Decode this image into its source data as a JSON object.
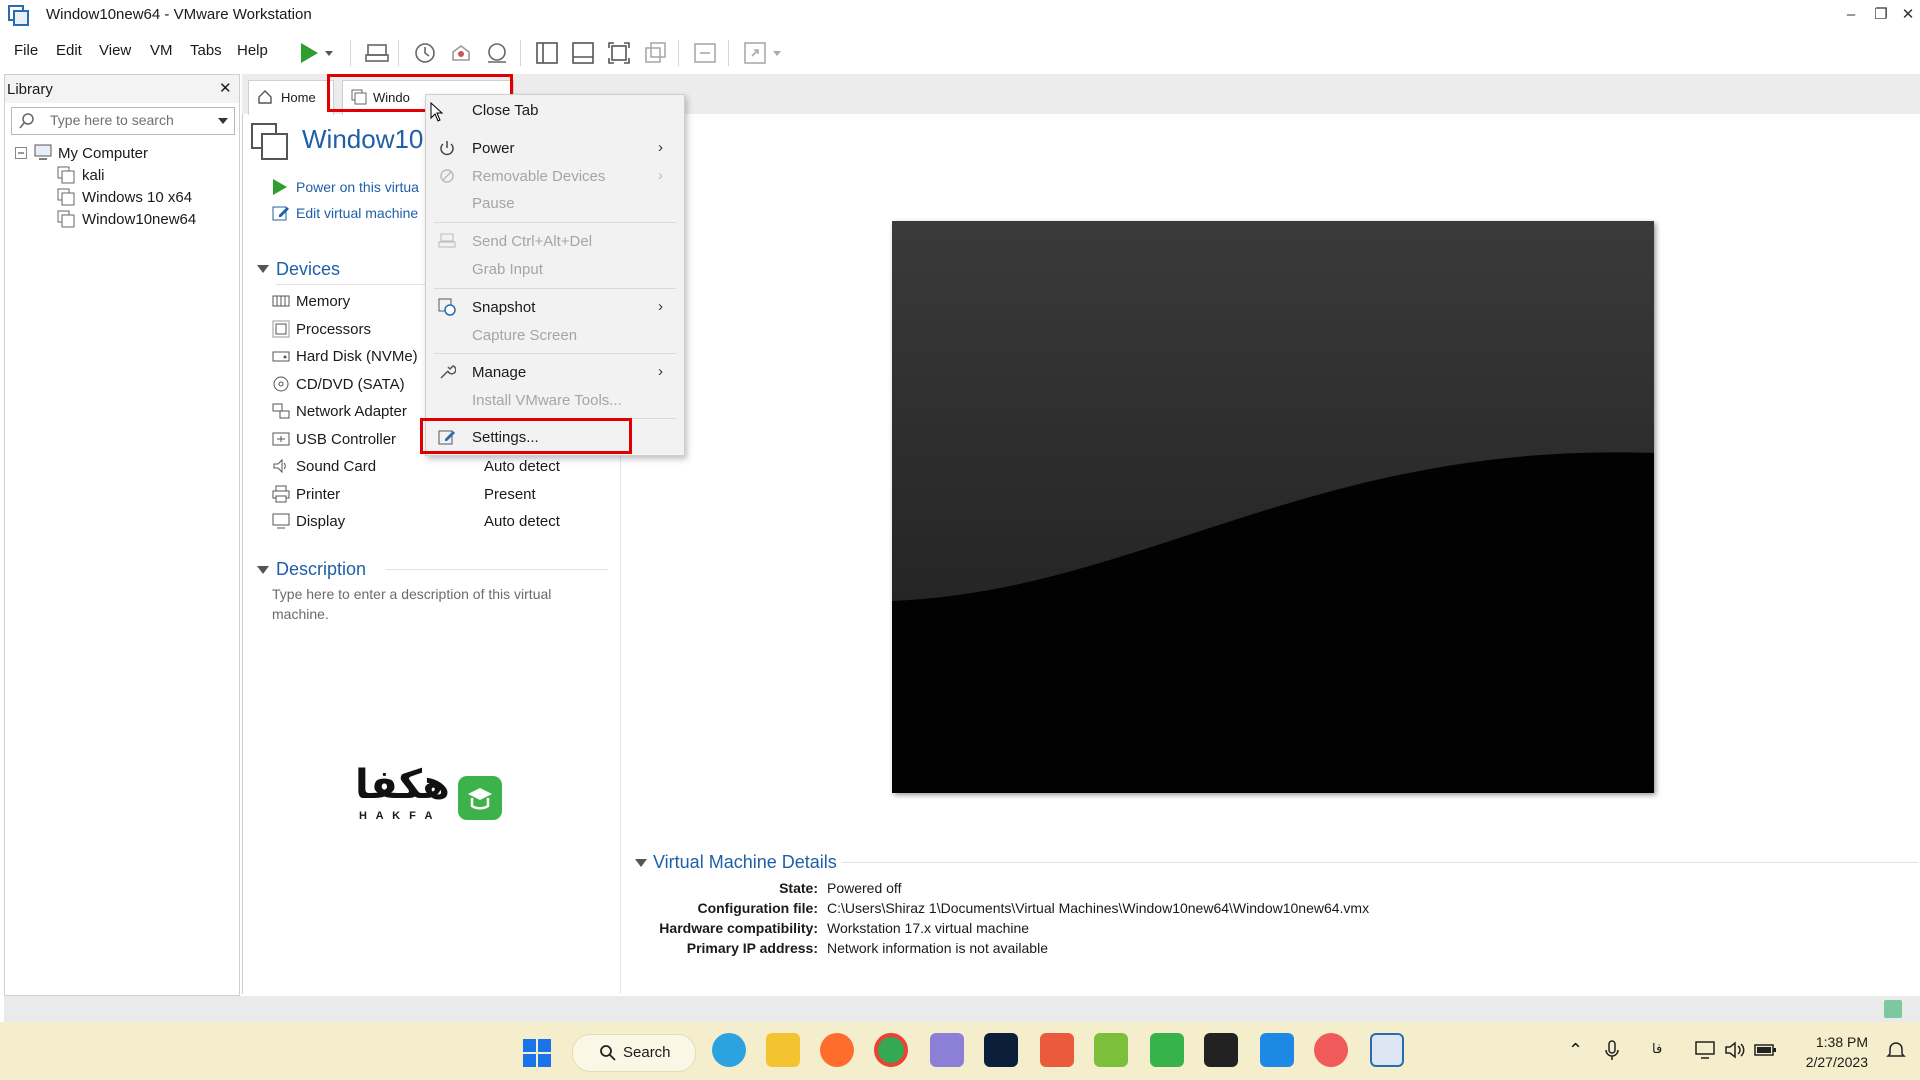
{
  "window": {
    "title": "Window10new64 - VMware Workstation",
    "minimize_glyph": "–",
    "maximize_glyph": "❐",
    "close_glyph": "✕"
  },
  "menu": {
    "file": "File",
    "edit": "Edit",
    "view": "View",
    "vm": "VM",
    "tabs": "Tabs",
    "help": "Help"
  },
  "toolbar_icons": [
    "play-icon",
    "dropdown-icon",
    "send-keys-icon",
    "snapshot-icon",
    "revert-snapshot-icon",
    "snapshot-manager-icon",
    "library-view-icon",
    "thumbnail-bar-icon",
    "fullscreen-icon",
    "unity-icon",
    "console-view-icon",
    "stretch-icon"
  ],
  "library": {
    "title": "Library",
    "close_glyph": "✕",
    "search_placeholder": "Type here to search",
    "root": "My Computer",
    "items": [
      "kali",
      "Windows 10 x64",
      "Window10new64"
    ]
  },
  "tabs": {
    "home": "Home",
    "vm_tab": "Windo"
  },
  "vm": {
    "name": "Window10r",
    "power_on": "Power on this virtua",
    "edit_settings": "Edit virtual machine"
  },
  "devices": {
    "header": "Devices",
    "items": [
      {
        "label": "Memory",
        "value": "",
        "icon": "memory-icon"
      },
      {
        "label": "Processors",
        "value": "",
        "icon": "processor-icon"
      },
      {
        "label": "Hard Disk (NVMe)",
        "value": "",
        "icon": "hard-disk-icon"
      },
      {
        "label": "CD/DVD (SATA)",
        "value": "",
        "icon": "cd-dvd-icon"
      },
      {
        "label": "Network Adapter",
        "value": "",
        "icon": "network-adapter-icon"
      },
      {
        "label": "USB Controller",
        "value": "",
        "icon": "usb-controller-icon"
      },
      {
        "label": "Sound Card",
        "value": "Auto detect",
        "icon": "sound-card-icon"
      },
      {
        "label": "Printer",
        "value": "Present",
        "icon": "printer-icon"
      },
      {
        "label": "Display",
        "value": "Auto detect",
        "icon": "display-icon"
      }
    ]
  },
  "description": {
    "header": "Description",
    "placeholder_line1": "Type here to enter a description of this virtual",
    "placeholder_line2": "machine."
  },
  "logo": {
    "text": "هکفا",
    "sub": "H A K F A"
  },
  "context_menu": {
    "close_tab": "Close Tab",
    "power": "Power",
    "removable_devices": "Removable Devices",
    "pause": "Pause",
    "send_ctrl_alt_del": "Send Ctrl+Alt+Del",
    "grab_input": "Grab Input",
    "snapshot": "Snapshot",
    "capture_screen": "Capture Screen",
    "manage": "Manage",
    "install_tools": "Install VMware Tools...",
    "settings": "Settings..."
  },
  "details": {
    "header": "Virtual Machine Details",
    "state_label": "State:",
    "state_value": "Powered off",
    "config_label": "Configuration file:",
    "config_value": "C:\\Users\\Shiraz 1\\Documents\\Virtual Machines\\Window10new64\\Window10new64.vmx",
    "compat_label": "Hardware compatibility:",
    "compat_value": "Workstation 17.x virtual machine",
    "ip_label": "Primary IP address:",
    "ip_value": "Network information is not available"
  },
  "taskbar": {
    "search_label": "Search",
    "time": "1:38 PM",
    "date": "2/27/2023",
    "lang": "فا",
    "apps": [
      "windows-start-icon",
      "telegram-icon",
      "file-explorer-icon",
      "firefox-icon",
      "chrome-icon",
      "snipping-tool-icon",
      "photoshop-icon",
      "camtasia-icon",
      "bluestacks-icon",
      "camtasia-recorder-icon",
      "sticky-notes-icon",
      "vscode-icon",
      "kinemaster-icon",
      "vmware-icon"
    ]
  },
  "colors": {
    "accent_blue": "#1f5fa8",
    "highlight_red": "#e00000",
    "taskbar_bg": "#f5eecc",
    "play_green": "#2e9e2e"
  }
}
